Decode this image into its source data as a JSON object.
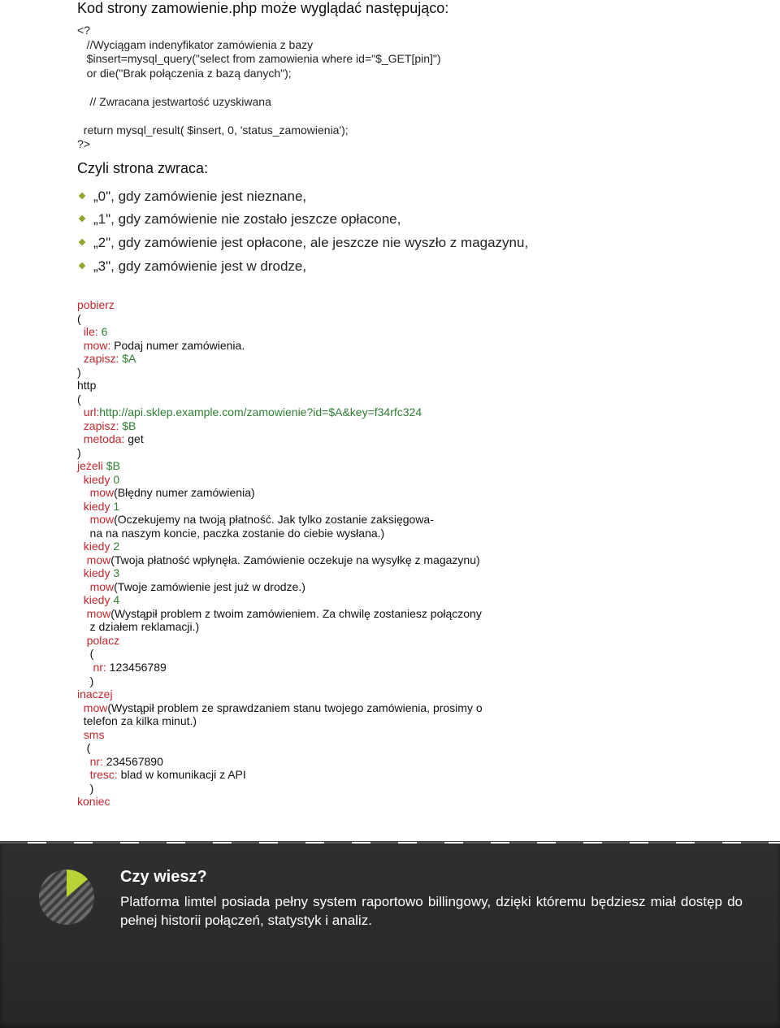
{
  "intro_heading": "Kod strony zamowienie.php może wyglądać następująco:",
  "php_code": "<?\n   //Wyciągam indenyfikator zamówienia z bazy\n   $insert=mysql_query(\"select from zamowienia where id=\"$_GET[pin]\")\n   or die(\"Brak połączenia z bazą danych\");\n\n    // Zwracana jestwartość uzyskiwana\n\n  return mysql_result( $insert, 0, 'status_zamowienia');\n?>",
  "sub_heading": "Czyli strona zwraca:",
  "list_items": [
    "„0\", gdy zamówienie jest nieznane,",
    "„1\", gdy zamówienie nie zostało jeszcze opłacone,",
    "„2\", gdy zamówienie jest opłacone, ale jeszcze nie wyszło z magazynu,",
    "„3\", gdy zamówienie jest w drodze,"
  ],
  "script": {
    "pobierz": "pobierz",
    "ile": "ile:",
    "ile_v": " 6",
    "mow1": "mow:",
    "mow1_v": " Podaj numer zamówienia.",
    "zapisz1": "zapisz:",
    "zapisz1_v": " $A",
    "http": "http",
    "url": "url:",
    "url_v": "http://api.sklep.example.com/zamowienie?id=$A&key=f34rfc324",
    "zapisz2": "zapisz:",
    "zapisz2_v": " $B",
    "metoda": "metoda:",
    "metoda_v": " get",
    "jezeli": "jeżeli",
    "jezeli_v": " $B",
    "kiedy0": "kiedy",
    "kiedy0_v": " 0",
    "mow_k0": "mow",
    "mow_k0_v": "(Błędny numer zamówienia)",
    "kiedy1": "kiedy",
    "kiedy1_v": " 1",
    "mow_k1": "mow",
    "mow_k1_v": "(Oczekujemy na twoją płatność. Jak tylko zostanie zaksięgowa-",
    "mow_k1_v2": "    na na naszym koncie, paczka zostanie do ciebie wysłana.)",
    "kiedy2": "kiedy",
    "kiedy2_v": " 2",
    "mow_k2": "mow",
    "mow_k2_v": "(Twoja płatność wpłynęła. Zamówienie oczekuje na wysyłkę z magazynu)",
    "kiedy3": "kiedy",
    "kiedy3_v": " 3",
    "mow_k3": "mow",
    "mow_k3_v": "(Twoje zamówienie jest już w drodze.)",
    "kiedy4": "kiedy",
    "kiedy4_v": " 4",
    "mow_k4": "mow",
    "mow_k4_v": "(Wystąpił problem z twoim zamówieniem. Za chwilę zostaniesz połączony",
    "mow_k4_v2": "    z działem reklamacji.)",
    "polacz": "polacz",
    "nr1": "nr:",
    "nr1_v": " 123456789",
    "inaczej": "inaczej",
    "mow_else": "mow",
    "mow_else_v": "(Wystąpił problem ze sprawdzaniem stanu twojego zamówienia, prosimy o",
    "mow_else_v2": "  telefon za kilka minut.)",
    "sms": "sms",
    "nr2": "nr:",
    "nr2_v": " 234567890",
    "tresc": "tresc:",
    "tresc_v": " blad w komunikacji z API",
    "koniec": "koniec",
    "paren_o": "(",
    "paren_c": ")"
  },
  "footer": {
    "title": "Czy wiesz?",
    "body": "Platforma limtel posiada pełny system raportowo billingowy, dzięki któremu będziesz miał dostęp do pełnej historii połączeń, statystyk i analiz."
  }
}
